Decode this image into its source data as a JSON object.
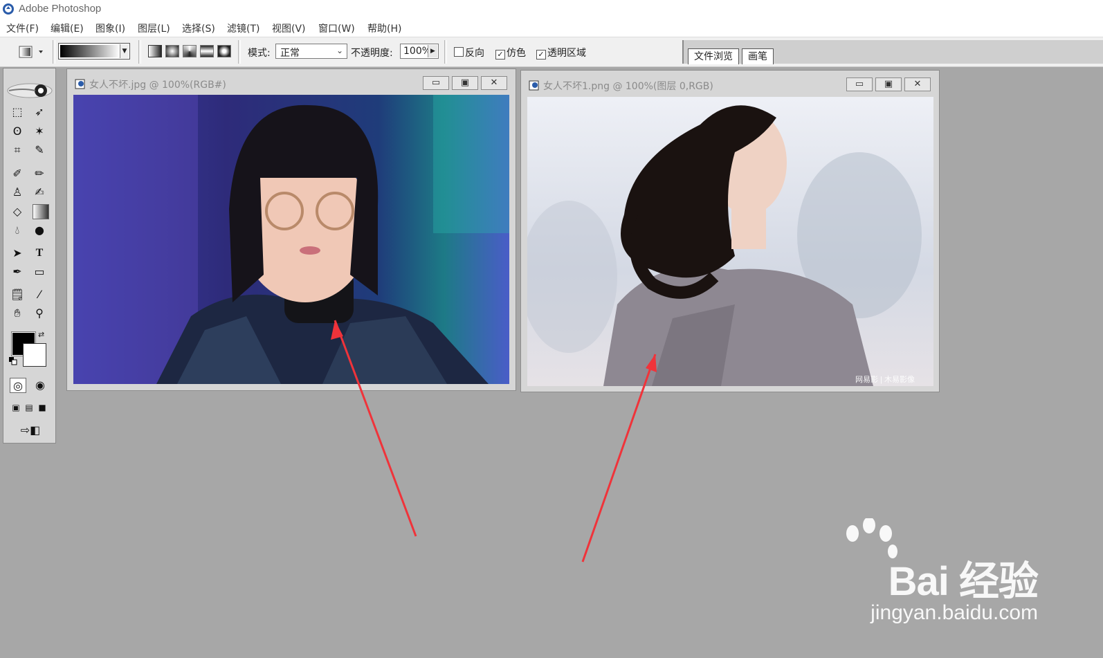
{
  "app": {
    "title": "Adobe Photoshop"
  },
  "menu": [
    "文件(F)",
    "编辑(E)",
    "图象(I)",
    "图层(L)",
    "选择(S)",
    "滤镜(T)",
    "视图(V)",
    "窗口(W)",
    "帮助(H)"
  ],
  "options": {
    "mode_label": "模式:",
    "mode_value": "正常",
    "opacity_label": "不透明度:",
    "opacity_value": "100%",
    "reverse_label": "反向",
    "dither_label": "仿色",
    "transparency_label": "透明区域",
    "reverse_checked": false,
    "dither_checked": true,
    "transparency_checked": true
  },
  "palette_well": {
    "tabs": [
      "文件浏览",
      "画笔"
    ]
  },
  "windows": [
    {
      "title": "女人不坏.jpg @ 100%(RGB#)"
    },
    {
      "title": "女人不坏1.png @ 100%(图层 0,RGB)"
    }
  ],
  "window_controls": {
    "minimize": "▭",
    "maximize": "▣",
    "close": "✕"
  },
  "colors": {
    "foreground": "#000000",
    "background": "#ffffff",
    "arrow": "#f0333a",
    "workspace": "#a7a7a7"
  },
  "watermark": {
    "brand": "Bai 经验",
    "url": "jingyan.baidu.com",
    "photo_credit": "网易影 | 木易影像"
  }
}
